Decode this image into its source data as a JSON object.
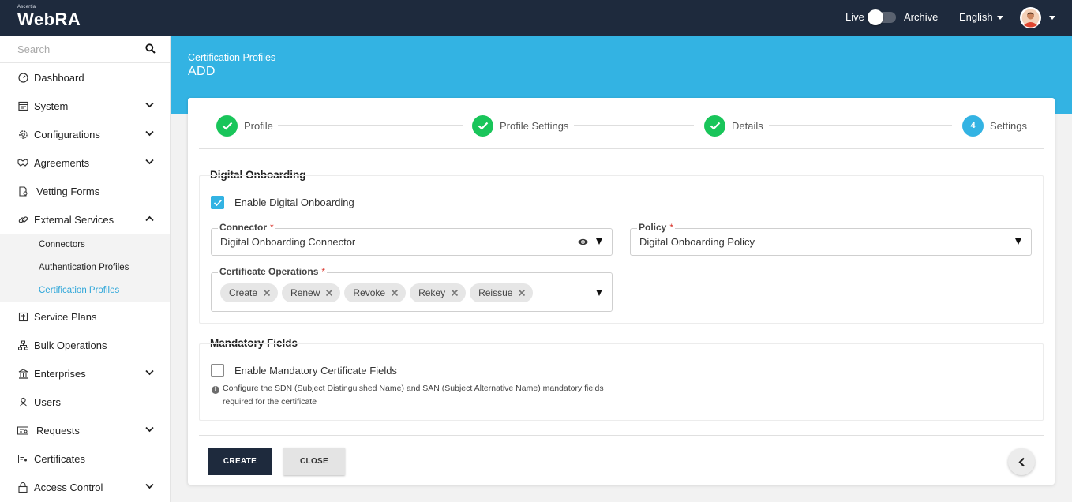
{
  "app": {
    "brand_small": "Ascertia",
    "brand": "WebRA"
  },
  "topbar": {
    "live_label": "Live",
    "archive_label": "Archive",
    "language": "English"
  },
  "sidebar": {
    "search_placeholder": "Search",
    "items": [
      {
        "label": "Dashboard",
        "icon": "dashboard-icon"
      },
      {
        "label": "System",
        "icon": "system-icon",
        "expandable": true
      },
      {
        "label": "Configurations",
        "icon": "gear-icon",
        "expandable": true
      },
      {
        "label": "Agreements",
        "icon": "handshake-icon",
        "expandable": true
      },
      {
        "label": "Vetting Forms",
        "icon": "vetting-form-icon"
      },
      {
        "label": "External Services",
        "icon": "link-icon",
        "expandable": true,
        "expanded": true
      }
    ],
    "sub_items": [
      {
        "label": "Connectors"
      },
      {
        "label": "Authentication Profiles"
      },
      {
        "label": "Certification Profiles",
        "active": true
      }
    ],
    "items_after": [
      {
        "label": "Service Plans",
        "icon": "service-plans-icon"
      },
      {
        "label": "Bulk Operations",
        "icon": "bulk-operations-icon"
      },
      {
        "label": "Enterprises",
        "icon": "building-icon",
        "expandable": true
      },
      {
        "label": "Users",
        "icon": "user-icon"
      },
      {
        "label": "Requests",
        "icon": "requests-icon",
        "expandable": true
      },
      {
        "label": "Certificates",
        "icon": "certificate-icon"
      },
      {
        "label": "Access Control",
        "icon": "lock-icon",
        "expandable": true
      }
    ]
  },
  "banner": {
    "breadcrumb": "Certification Profiles",
    "title": "ADD"
  },
  "stepper": {
    "steps": [
      {
        "label": "Profile",
        "state": "done"
      },
      {
        "label": "Profile Settings",
        "state": "done"
      },
      {
        "label": "Details",
        "state": "done"
      },
      {
        "label": "Settings",
        "state": "current",
        "number": "4"
      }
    ]
  },
  "digital_onboarding": {
    "title": "Digital Onboarding",
    "enable_label": "Enable Digital Onboarding",
    "enabled": true,
    "connector_label": "Connector",
    "connector_value": "Digital Onboarding Connector",
    "policy_label": "Policy",
    "policy_value": "Digital Onboarding Policy",
    "operations_label": "Certificate Operations",
    "operations": [
      "Create",
      "Renew",
      "Revoke",
      "Rekey",
      "Reissue"
    ],
    "required_marker": "*"
  },
  "mandatory_fields": {
    "title": "Mandatory Fields",
    "enable_label": "Enable Mandatory Certificate Fields",
    "enabled": false,
    "hint_line1": "Configure the SDN (Subject Distinguished Name) and SAN (Subject Alternative Name) mandatory fields",
    "hint_line2": "required for the certificate",
    "info_glyph": "i"
  },
  "footer": {
    "create_label": "CREATE",
    "close_label": "CLOSE"
  },
  "colors": {
    "topbar": "#1e2a3d",
    "accent": "#33b3e3",
    "success": "#19c55a",
    "required": "#d9342b"
  }
}
